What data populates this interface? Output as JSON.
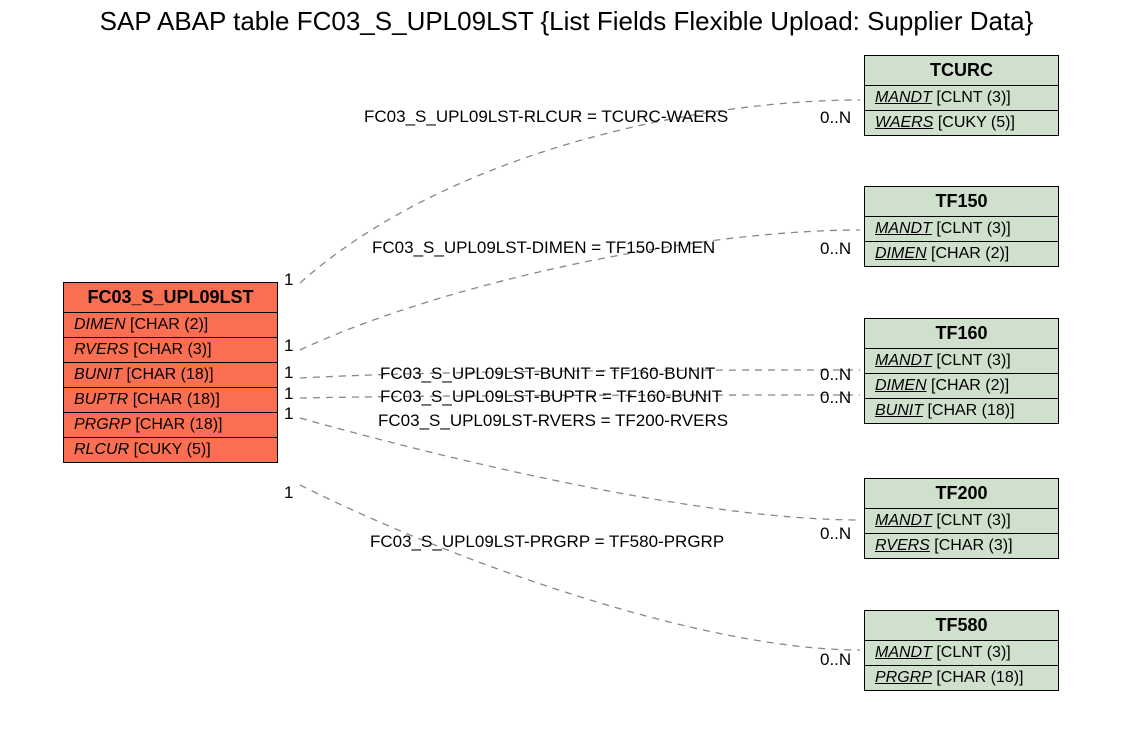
{
  "title": "SAP ABAP table FC03_S_UPL09LST {List Fields Flexible Upload: Supplier Data}",
  "main_entity": {
    "name": "FC03_S_UPL09LST",
    "fields": [
      {
        "name": "DIMEN",
        "type": "[CHAR (2)]"
      },
      {
        "name": "RVERS",
        "type": "[CHAR (3)]"
      },
      {
        "name": "BUNIT",
        "type": "[CHAR (18)]"
      },
      {
        "name": "BUPTR",
        "type": "[CHAR (18)]"
      },
      {
        "name": "PRGRP",
        "type": "[CHAR (18)]"
      },
      {
        "name": "RLCUR",
        "type": "[CUKY (5)]"
      }
    ]
  },
  "rel_entities": [
    {
      "name": "TCURC",
      "fields": [
        {
          "name": "MANDT",
          "type": "[CLNT (3)]"
        },
        {
          "name": "WAERS",
          "type": "[CUKY (5)]"
        }
      ]
    },
    {
      "name": "TF150",
      "fields": [
        {
          "name": "MANDT",
          "type": "[CLNT (3)]"
        },
        {
          "name": "DIMEN",
          "type": "[CHAR (2)]"
        }
      ]
    },
    {
      "name": "TF160",
      "fields": [
        {
          "name": "MANDT",
          "type": "[CLNT (3)]"
        },
        {
          "name": "DIMEN",
          "type": "[CHAR (2)]"
        },
        {
          "name": "BUNIT",
          "type": "[CHAR (18)]"
        }
      ]
    },
    {
      "name": "TF200",
      "fields": [
        {
          "name": "MANDT",
          "type": "[CLNT (3)]"
        },
        {
          "name": "RVERS",
          "type": "[CHAR (3)]"
        }
      ]
    },
    {
      "name": "TF580",
      "fields": [
        {
          "name": "MANDT",
          "type": "[CLNT (3)]"
        },
        {
          "name": "PRGRP",
          "type": "[CHAR (18)]"
        }
      ]
    }
  ],
  "edges": [
    {
      "label": "FC03_S_UPL09LST-RLCUR = TCURC-WAERS",
      "left_card": "1",
      "right_card": "0..N"
    },
    {
      "label": "FC03_S_UPL09LST-DIMEN = TF150-DIMEN",
      "left_card": "1",
      "right_card": "0..N"
    },
    {
      "label": "FC03_S_UPL09LST-BUNIT = TF160-BUNIT",
      "left_card": "1",
      "right_card": "0..N"
    },
    {
      "label": "FC03_S_UPL09LST-BUPTR = TF160-BUNIT",
      "left_card": "1",
      "right_card": "0..N"
    },
    {
      "label": "FC03_S_UPL09LST-RVERS = TF200-RVERS",
      "left_card": "1",
      "right_card": "0..N"
    },
    {
      "label": "FC03_S_UPL09LST-PRGRP = TF580-PRGRP",
      "left_card": "1",
      "right_card": "0..N"
    }
  ]
}
